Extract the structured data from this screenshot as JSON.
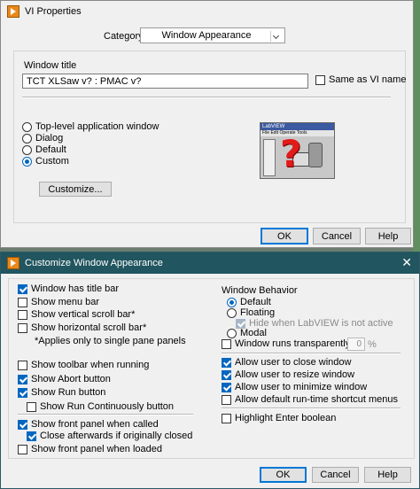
{
  "vi_props": {
    "title": "VI Properties",
    "category_label": "Category",
    "category_value": "Window Appearance",
    "window_title_group": "Window title",
    "window_title_value": "TCT XLSaw v? : PMAC v?",
    "same_as_vi_name": "Same as VI name",
    "radios": [
      "Top-level application window",
      "Dialog",
      "Default",
      "Custom"
    ],
    "selected_radio": "Custom",
    "customize_label": "Customize...",
    "ok": "OK",
    "cancel": "Cancel",
    "help": "Help",
    "preview": {
      "app": "LabVIEW",
      "menu": "File  Edit  Operate  Tools"
    }
  },
  "customize": {
    "title": "Customize Window Appearance",
    "left": [
      {
        "label": "Window has title bar",
        "checked": true
      },
      {
        "label": "Show menu bar",
        "checked": false
      },
      {
        "label": "Show vertical scroll bar*",
        "checked": false
      },
      {
        "label": "Show horizontal scroll bar*",
        "checked": false
      },
      {
        "label": "*Applies only to single pane panels",
        "note": true
      },
      {
        "label": "Show toolbar when running",
        "checked": false
      },
      {
        "label": "Show Abort button",
        "checked": true
      },
      {
        "label": "Show Run button",
        "checked": true
      },
      {
        "label": "Show Run Continuously button",
        "checked": false
      },
      {
        "label": "Show front panel when called",
        "checked": true
      },
      {
        "label": "Close afterwards if originally closed",
        "checked": true
      },
      {
        "label": "Show front panel when loaded",
        "checked": false
      }
    ],
    "behavior_label": "Window Behavior",
    "behavior": [
      "Default",
      "Floating",
      "Modal"
    ],
    "behavior_selected": "Default",
    "hide_when": "Hide when LabVIEW is not active",
    "transparent_label": "Window runs transparently",
    "transparent_value": "0",
    "percent": "%",
    "right_checks": [
      {
        "label": "Allow user to close window",
        "checked": true
      },
      {
        "label": "Allow user to resize window",
        "checked": true
      },
      {
        "label": "Allow user to minimize window",
        "checked": true
      },
      {
        "label": "Allow default run-time shortcut menus",
        "checked": false
      },
      {
        "label": "Highlight Enter boolean",
        "checked": false
      }
    ],
    "ok": "OK",
    "cancel": "Cancel",
    "help": "Help"
  }
}
